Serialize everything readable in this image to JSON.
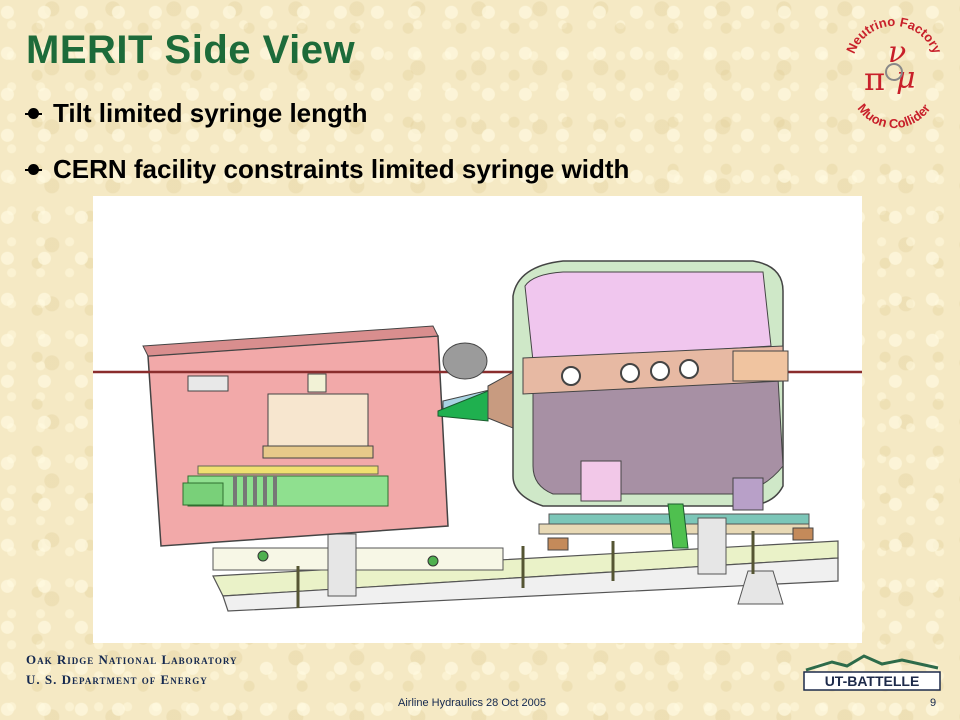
{
  "slide": {
    "title": "MERIT Side View",
    "bullets": [
      "Tilt limited syringe length",
      "CERN facility constraints limited syringe width"
    ]
  },
  "logo_top": {
    "arc_top": "Neutrino Factory",
    "arc_bottom": "Muon Collider",
    "symbol_nu": "ν",
    "symbol_pi": "π",
    "symbol_mu": "μ"
  },
  "footer": {
    "org_line1": "Oak Ridge National Laboratory",
    "org_line2": "U. S. Department of Energy",
    "center_text": "Airline Hydraulics 28 Oct 2005",
    "page_number": "9",
    "partner_logo_text": "UT-BATTELLE"
  },
  "colors": {
    "title": "#1d6b3a",
    "footer_text": "#14284f",
    "logo_red": "#c8202a",
    "background": "#f5e9c4"
  }
}
